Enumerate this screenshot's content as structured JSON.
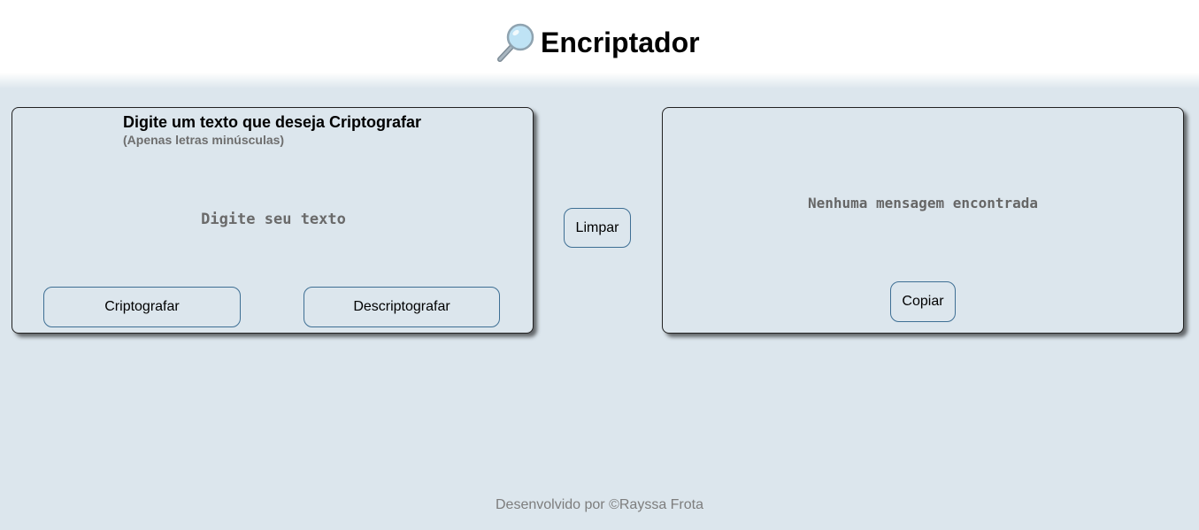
{
  "header": {
    "logo_icon": "magnifying-glass-icon",
    "title": "Encriptador"
  },
  "input_panel": {
    "heading": "Digite um texto que deseja Criptografar",
    "hint": "(Apenas letras minúsculas)",
    "textarea": {
      "placeholder": "Digite seu texto",
      "value": ""
    },
    "encrypt_label": "Criptografar",
    "decrypt_label": "Descriptografar"
  },
  "actions": {
    "clear_label": "Limpar"
  },
  "output_panel": {
    "message": "Nenhuma mensagem encontrada",
    "copy_label": "Copiar"
  },
  "footer": {
    "text": "Desenvolvido por ©Rayssa Frota"
  },
  "colors": {
    "page_background": "#dce6ed",
    "header_background": "#ffffff",
    "button_border": "#3e6f94",
    "hint_text": "#6e6e6e",
    "footer_text": "#7d7d7d"
  }
}
